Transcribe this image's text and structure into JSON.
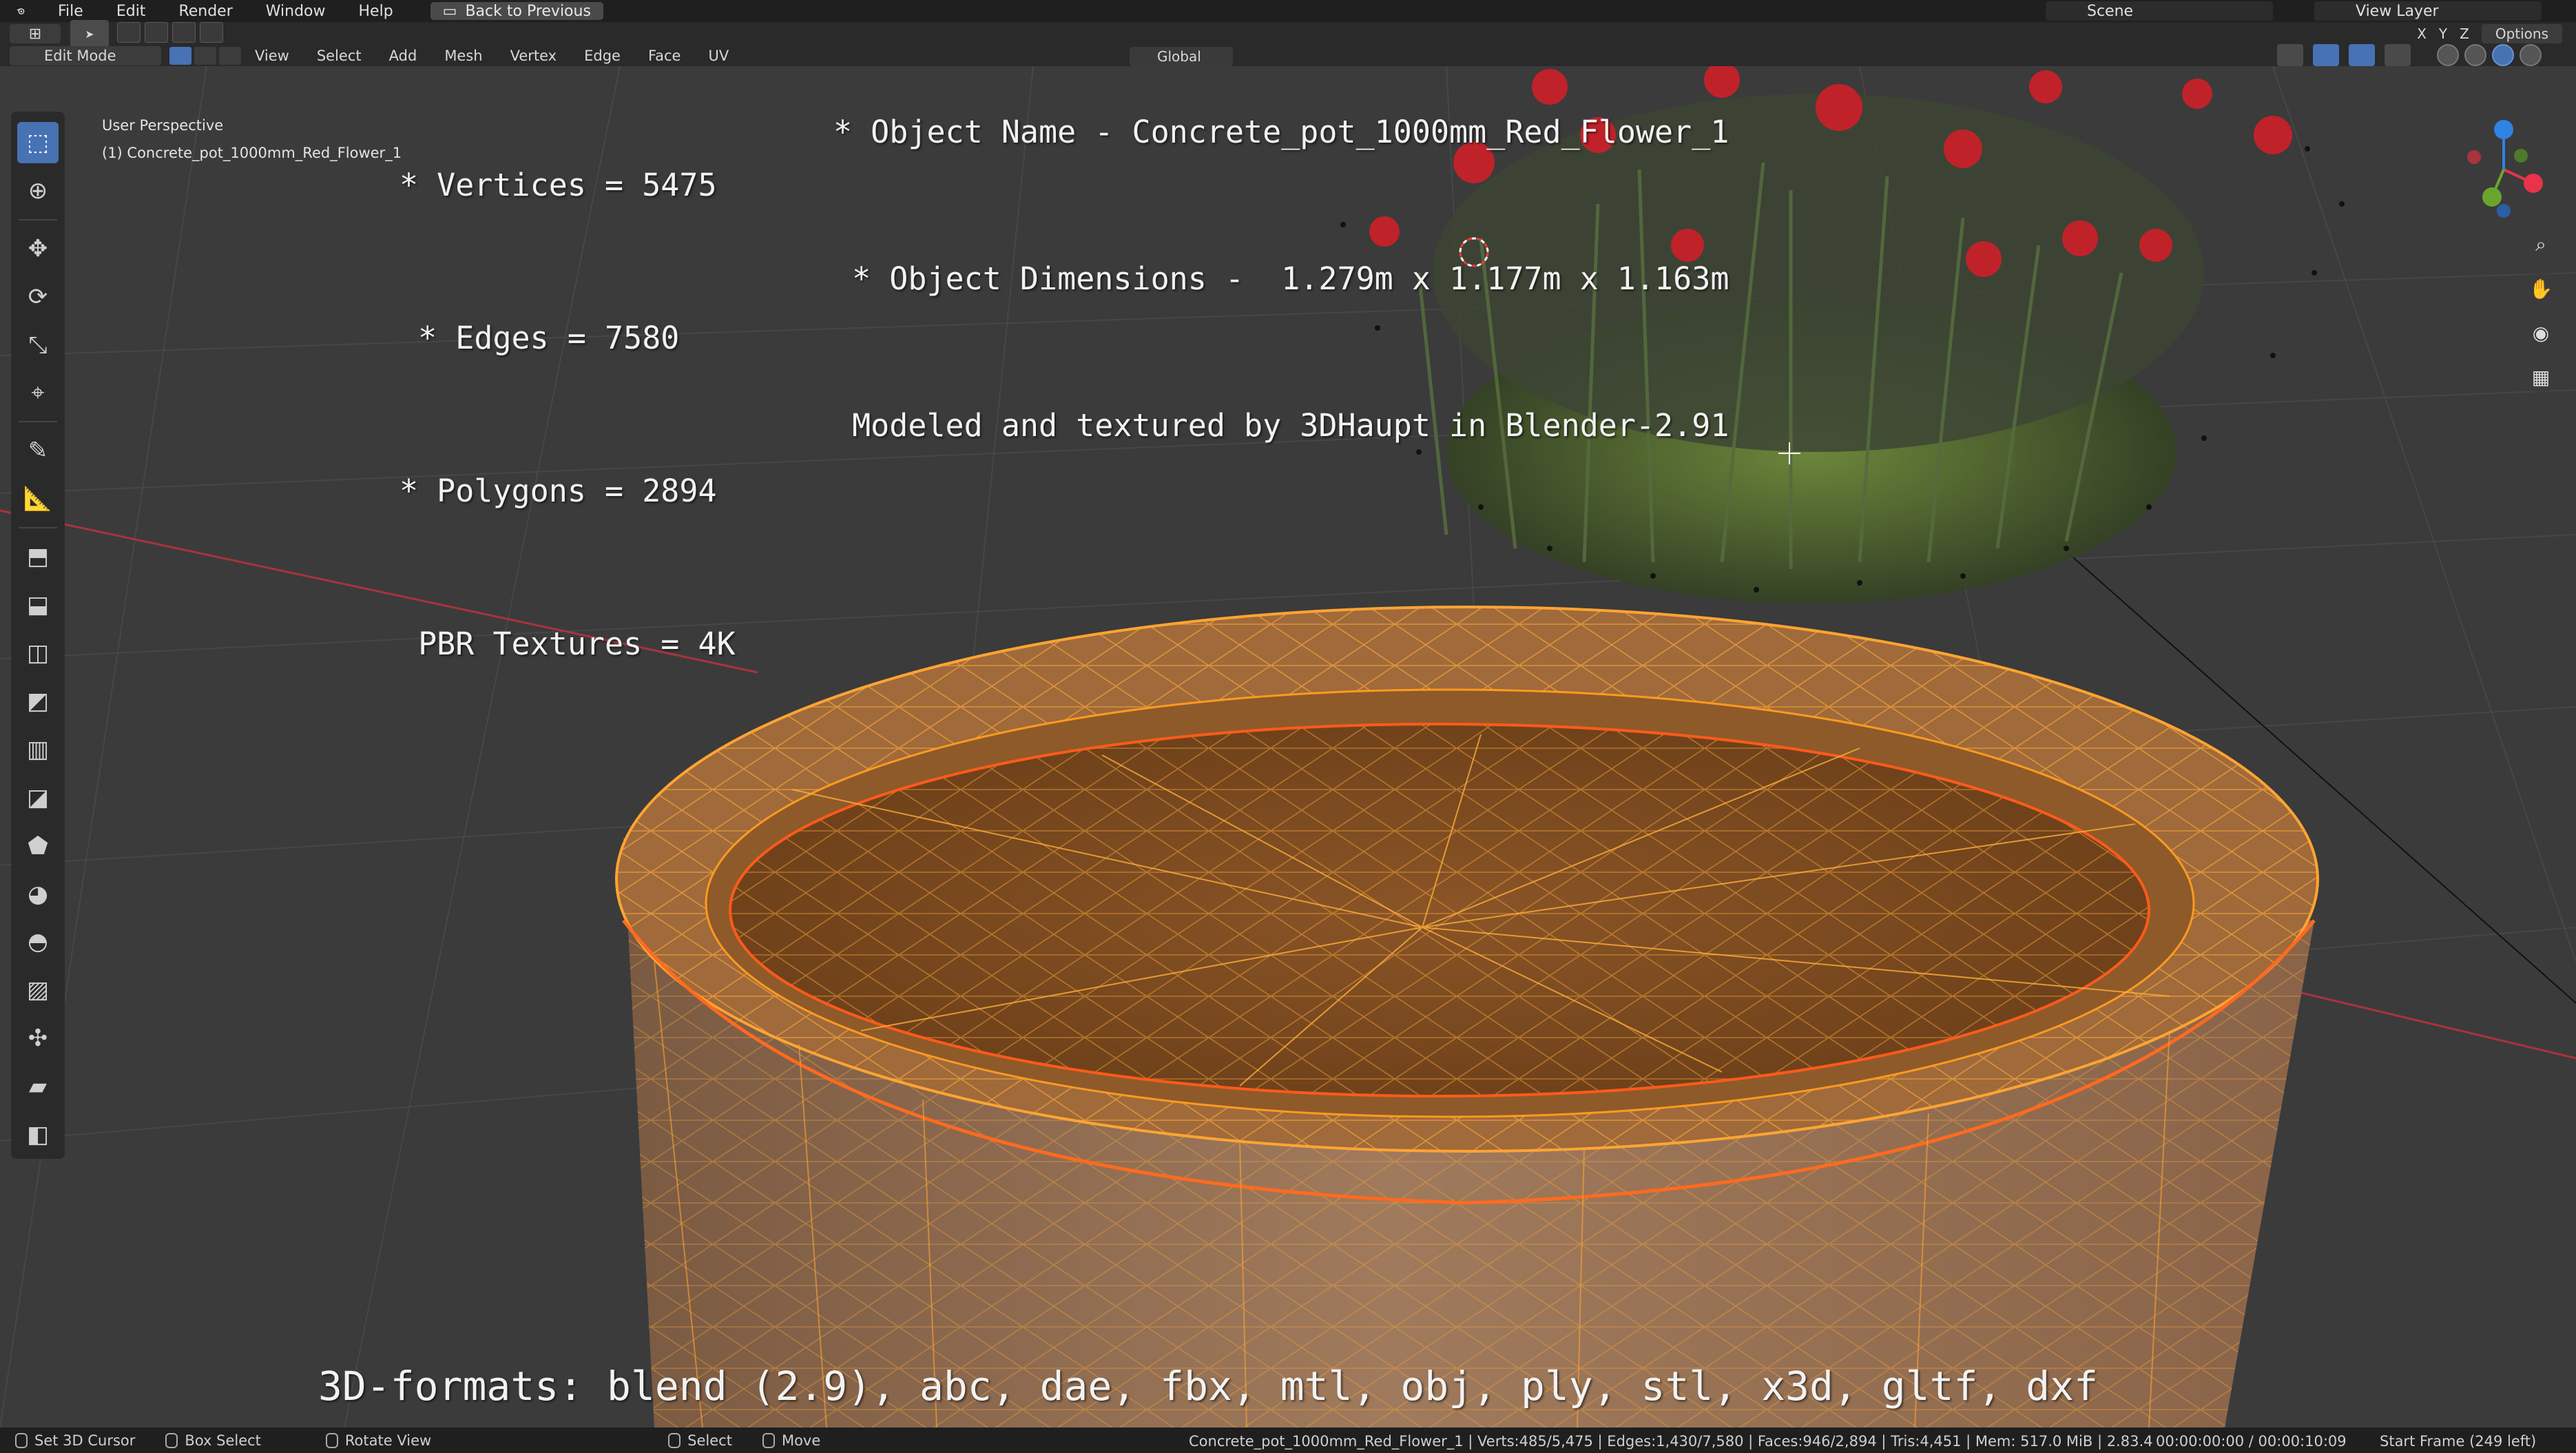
{
  "menubar": {
    "items": [
      "File",
      "Edit",
      "Render",
      "Window",
      "Help"
    ],
    "back_button": "Back to Previous",
    "scene_name": "Scene",
    "view_layer": "View Layer"
  },
  "header": {
    "mode": "Edit Mode",
    "menus": [
      "View",
      "Select",
      "Add",
      "Mesh",
      "Vertex",
      "Edge",
      "Face",
      "UV"
    ],
    "transform_orientation": "Global",
    "axis_toggles": [
      "X",
      "Y",
      "Z"
    ],
    "options_label": "Options"
  },
  "viewport": {
    "view_name": "User Perspective",
    "object_label": "(1) Concrete_pot_1000mm_Red_Flower_1"
  },
  "overlay_text": {
    "vertices": "* Vertices = 5475",
    "edges": " * Edges = 7580",
    "polygons": "* Polygons = 2894",
    "textures": " PBR Textures = 4K",
    "object_name": "* Object Name - Concrete_pot_1000mm_Red_Flower_1",
    "object_dims": " * Object Dimensions -  1.279m x 1.177m x 1.163m",
    "modeled_by": " Modeled and textured by 3DHaupt in Blender-2.91",
    "formats": "3D-formats: blend (2.9), abc, dae, fbx, mtl, obj, ply, stl, x3d, gltf, dxf"
  },
  "toolbar": {
    "tools": [
      "select-box-icon",
      "cursor-icon",
      "move-icon",
      "rotate-icon",
      "scale-icon",
      "transform-icon",
      "annotate-icon",
      "measure-icon",
      "add-cube-icon",
      "extrude-icon",
      "inset-icon",
      "bevel-icon",
      "loop-cut-icon",
      "knife-icon",
      "poly-build-icon",
      "spin-icon",
      "smooth-icon",
      "edge-slide-icon",
      "shrink-fatten-icon",
      "shear-icon",
      "rip-icon"
    ]
  },
  "gizmo": {
    "x_color": "#e8334a",
    "y_color": "#6aa62e",
    "z_color": "#2f83e3"
  },
  "statusbar": {
    "left_items": [
      "Set 3D Cursor",
      "Box Select",
      "Rotate View",
      "Select",
      "Move"
    ],
    "stats": "Concrete_pot_1000mm_Red_Flower_1 | Verts:485/5,475 | Edges:1,430/7,580 | Faces:946/2,894 | Tris:4,451 | Mem: 517.0 MiB | 2.83.4",
    "frame_time": "00:00:00:00 / 00:00:10:09",
    "start_frame": "Start Frame (249 left)"
  },
  "colors": {
    "accent": "#4772b3",
    "wire_selected": "#ff9a1f",
    "edge_highlight": "#ff5a1a"
  }
}
